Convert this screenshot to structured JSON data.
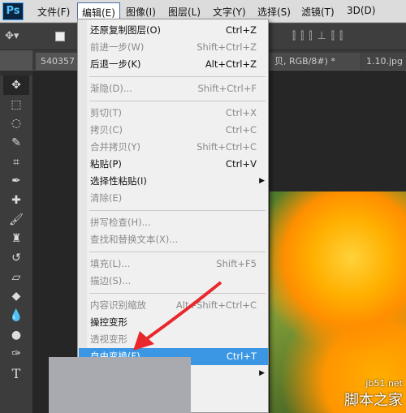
{
  "app": {
    "logo": "Ps"
  },
  "menubar": [
    "文件(F)",
    "编辑(E)",
    "图像(I)",
    "图层(L)",
    "文字(Y)",
    "选择(S)",
    "滤镜(T)",
    "3D(D)"
  ],
  "tabs": [
    "540357",
    "贝, RGB/8#) *",
    "1.10.jpg"
  ],
  "edit_menu": [
    {
      "label": "还原复制图层(O)",
      "shortcut": "Ctrl+Z",
      "state": "enabled"
    },
    {
      "label": "前进一步(W)",
      "shortcut": "Shift+Ctrl+Z",
      "state": "disabled"
    },
    {
      "label": "后退一步(K)",
      "shortcut": "Alt+Ctrl+Z",
      "state": "enabled"
    },
    {
      "sep": true
    },
    {
      "label": "渐隐(D)...",
      "shortcut": "Shift+Ctrl+F",
      "state": "disabled"
    },
    {
      "sep": true
    },
    {
      "label": "剪切(T)",
      "shortcut": "Ctrl+X",
      "state": "disabled"
    },
    {
      "label": "拷贝(C)",
      "shortcut": "Ctrl+C",
      "state": "disabled"
    },
    {
      "label": "合并拷贝(Y)",
      "shortcut": "Shift+Ctrl+C",
      "state": "disabled"
    },
    {
      "label": "粘贴(P)",
      "shortcut": "Ctrl+V",
      "state": "enabled"
    },
    {
      "label": "选择性粘贴(I)",
      "shortcut": "",
      "state": "enabled",
      "submenu": true
    },
    {
      "label": "清除(E)",
      "shortcut": "",
      "state": "disabled"
    },
    {
      "sep": true
    },
    {
      "label": "拼写检查(H)...",
      "shortcut": "",
      "state": "disabled"
    },
    {
      "label": "查找和替换文本(X)...",
      "shortcut": "",
      "state": "disabled"
    },
    {
      "sep": true
    },
    {
      "label": "填充(L)...",
      "shortcut": "Shift+F5",
      "state": "disabled"
    },
    {
      "label": "描边(S)...",
      "shortcut": "",
      "state": "disabled"
    },
    {
      "sep": true
    },
    {
      "label": "内容识别缩放",
      "shortcut": "Alt+Shift+Ctrl+C",
      "state": "disabled"
    },
    {
      "label": "操控变形",
      "shortcut": "",
      "state": "enabled"
    },
    {
      "label": "透视变形",
      "shortcut": "",
      "state": "disabled"
    },
    {
      "label": "自由变换(F)",
      "shortcut": "Ctrl+T",
      "state": "highlighted"
    },
    {
      "label": "",
      "shortcut": "",
      "state": "enabled",
      "submenu": true
    }
  ],
  "watermark": {
    "domain": "jb51.net",
    "cn": "脚本之家"
  },
  "colors": {
    "highlight": "#3b97e3",
    "arrow": "#e8282d"
  }
}
